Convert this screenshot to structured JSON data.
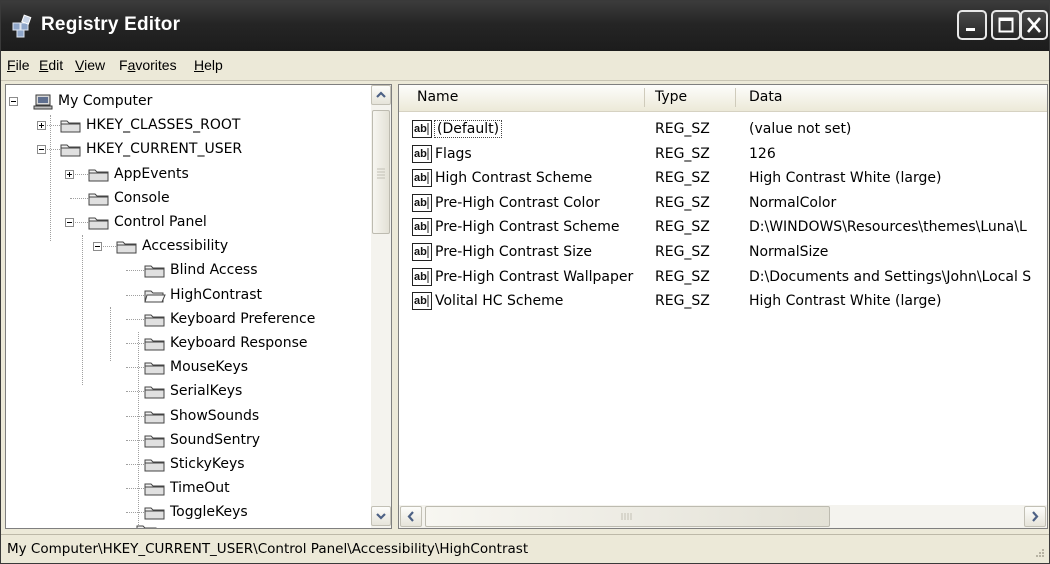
{
  "window": {
    "title": "Registry Editor"
  },
  "menu": [
    {
      "pre": "",
      "acc": "F",
      "post": "ile"
    },
    {
      "pre": "",
      "acc": "E",
      "post": "dit"
    },
    {
      "pre": "",
      "acc": "V",
      "post": "iew"
    },
    {
      "pre": "F",
      "acc": "a",
      "post": "vorites"
    },
    {
      "pre": "",
      "acc": "H",
      "post": "elp"
    }
  ],
  "tree": [
    {
      "label": "My Computer",
      "icon": "computer-icon",
      "expander": "minus"
    },
    {
      "label": "HKEY_CLASSES_ROOT",
      "icon": "folder-icon",
      "expander": "plus"
    },
    {
      "label": "HKEY_CURRENT_USER",
      "icon": "folder-icon",
      "expander": "minus"
    },
    {
      "label": "AppEvents",
      "icon": "folder-icon",
      "expander": "plus"
    },
    {
      "label": "Console",
      "icon": "folder-icon",
      "expander": "none"
    },
    {
      "label": "Control Panel",
      "icon": "folder-icon",
      "expander": "minus"
    },
    {
      "label": "Accessibility",
      "icon": "folder-icon",
      "expander": "minus"
    },
    {
      "label": "Blind Access",
      "icon": "folder-icon",
      "expander": "none"
    },
    {
      "label": "HighContrast",
      "icon": "open-folder-icon",
      "expander": "none",
      "selected": true
    },
    {
      "label": "Keyboard Preference",
      "icon": "folder-icon",
      "expander": "none"
    },
    {
      "label": "Keyboard Response",
      "icon": "folder-icon",
      "expander": "none"
    },
    {
      "label": "MouseKeys",
      "icon": "folder-icon",
      "expander": "none"
    },
    {
      "label": "SerialKeys",
      "icon": "folder-icon",
      "expander": "none"
    },
    {
      "label": "ShowSounds",
      "icon": "folder-icon",
      "expander": "none"
    },
    {
      "label": "SoundSentry",
      "icon": "folder-icon",
      "expander": "none"
    },
    {
      "label": "StickyKeys",
      "icon": "folder-icon",
      "expander": "none"
    },
    {
      "label": "TimeOut",
      "icon": "folder-icon",
      "expander": "none"
    },
    {
      "label": "ToggleKeys",
      "icon": "folder-icon",
      "expander": "none"
    }
  ],
  "list": {
    "columns": [
      "Name",
      "Type",
      "Data"
    ],
    "rows": [
      {
        "name": "(Default)",
        "type": "REG_SZ",
        "data": "(value not set)"
      },
      {
        "name": "Flags",
        "type": "REG_SZ",
        "data": "126"
      },
      {
        "name": "High Contrast Scheme",
        "type": "REG_SZ",
        "data": "High Contrast White (large)"
      },
      {
        "name": "Pre-High Contrast Color",
        "type": "REG_SZ",
        "data": "NormalColor"
      },
      {
        "name": "Pre-High Contrast Scheme",
        "type": "REG_SZ",
        "data": "D:\\WINDOWS\\Resources\\themes\\Luna\\L"
      },
      {
        "name": "Pre-High Contrast Size",
        "type": "REG_SZ",
        "data": "NormalSize"
      },
      {
        "name": "Pre-High Contrast Wallpaper",
        "type": "REG_SZ",
        "data": "D:\\Documents and Settings\\John\\Local S"
      },
      {
        "name": "Volital HC Scheme",
        "type": "REG_SZ",
        "data": "High Contrast White (large)"
      }
    ]
  },
  "status": {
    "path": "My Computer\\HKEY_CURRENT_USER\\Control Panel\\Accessibility\\HighContrast"
  }
}
